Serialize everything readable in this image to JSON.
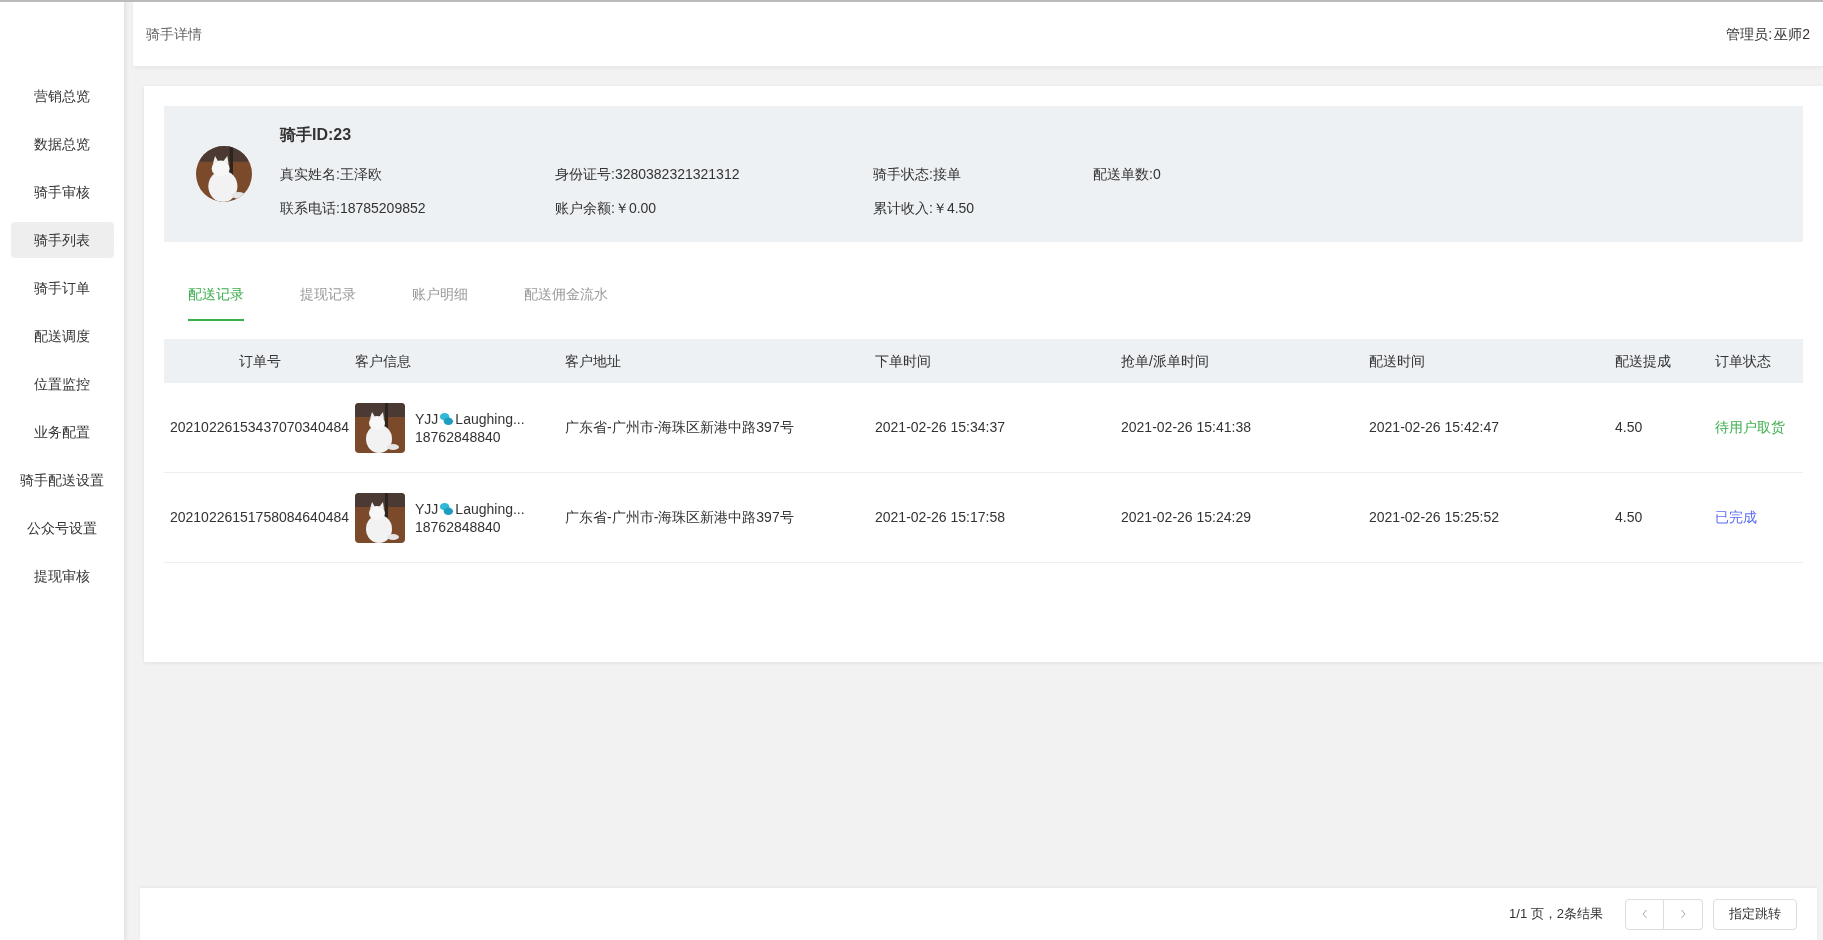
{
  "sidebar": {
    "items": [
      {
        "label": "营销总览",
        "selected": false
      },
      {
        "label": "数据总览",
        "selected": false
      },
      {
        "label": "骑手审核",
        "selected": false
      },
      {
        "label": "骑手列表",
        "selected": true
      },
      {
        "label": "骑手订单",
        "selected": false
      },
      {
        "label": "配送调度",
        "selected": false
      },
      {
        "label": "位置监控",
        "selected": false
      },
      {
        "label": "业务配置",
        "selected": false
      },
      {
        "label": "骑手配送设置",
        "selected": false
      },
      {
        "label": "公众号设置",
        "selected": false
      },
      {
        "label": "提现审核",
        "selected": false
      }
    ]
  },
  "header": {
    "title": "骑手详情",
    "admin_label": "管理员:",
    "admin_name": "巫师2"
  },
  "rider": {
    "title": "骑手ID:23",
    "fields": [
      [
        "真实姓名:王泽欧",
        "身份证号:3280382321321312",
        "骑手状态:接单",
        "配送单数:0"
      ],
      [
        "联系电话:18785209852",
        "账户余额:￥0.00",
        "累计收入:￥4.50"
      ]
    ]
  },
  "tabs": [
    {
      "label": "配送记录",
      "selected": true
    },
    {
      "label": "提现记录",
      "selected": false
    },
    {
      "label": "账户明细",
      "selected": false
    },
    {
      "label": "配送佣金流水",
      "selected": false
    }
  ],
  "table": {
    "columns": [
      "订单号",
      "客户信息",
      "客户地址",
      "下单时间",
      "抢单/派单时间",
      "配送时间",
      "配送提成",
      "订单状态"
    ],
    "rows": [
      {
        "order_no": "20210226153437070340484",
        "name_start": "YJJ",
        "name_end": "Laughing...",
        "phone": "18762848840",
        "address": "广东省-广州市-海珠区新港中路397号",
        "order_time": "2021-02-26 15:34:37",
        "grab_time": "2021-02-26 15:41:38",
        "delivery_time": "2021-02-26 15:42:47",
        "commission": "4.50",
        "status": "待用户取货",
        "color": "#3aaf4a"
      },
      {
        "order_no": "20210226151758084640484",
        "name_start": "YJJ",
        "name_end": "Laughing...",
        "phone": "18762848840",
        "address": "广东省-广州市-海珠区新港中路397号",
        "order_time": "2021-02-26 15:17:58",
        "grab_time": "2021-02-26 15:24:29",
        "delivery_time": "2021-02-26 15:25:52",
        "commission": "4.50",
        "status": "已完成",
        "color": "#5b6cf0"
      }
    ]
  },
  "pagination": {
    "summary": "1/1 页，2条结果",
    "jump": "指定跳转"
  }
}
